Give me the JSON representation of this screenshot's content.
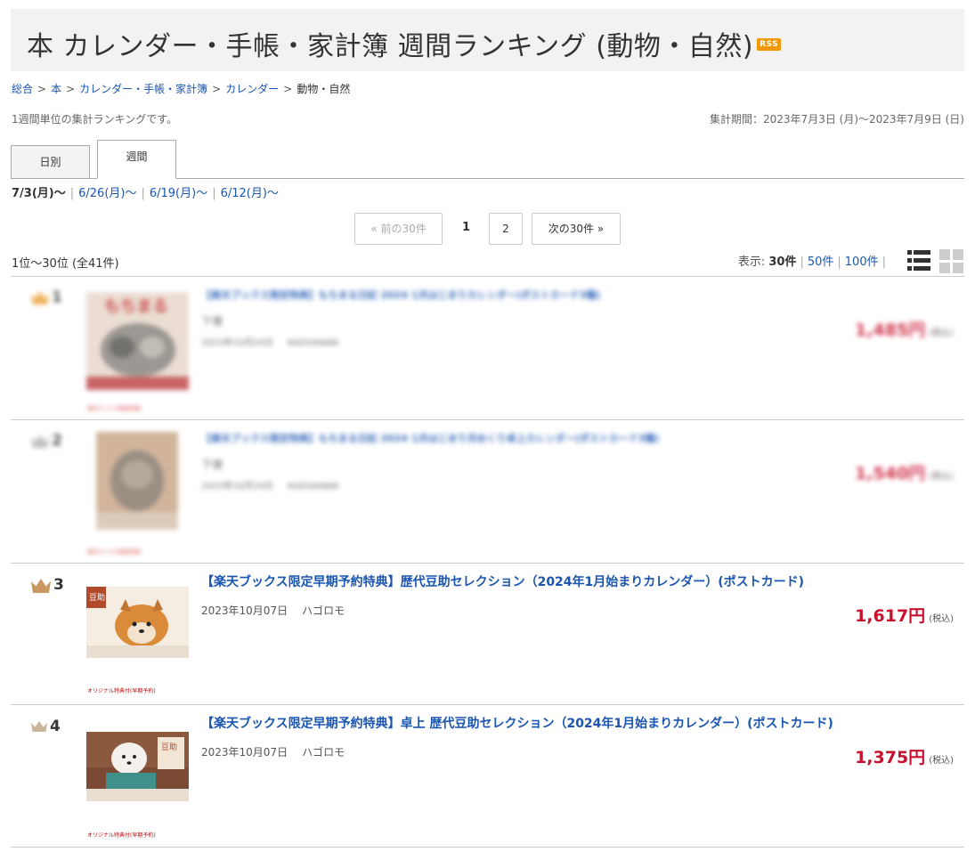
{
  "header": {
    "title": "本 カレンダー・手帳・家計簿 週間ランキング (動物・自然)",
    "rss_label": "RSS"
  },
  "breadcrumb": {
    "items": [
      "総合",
      "本",
      "カレンダー・手帳・家計簿",
      "カレンダー"
    ],
    "current": "動物・自然",
    "separator": ">"
  },
  "description": "1週間単位の集計ランキングです。",
  "period": "集計期間：2023年7月3日 (月)〜2023年7月9日 (日)",
  "tabs": [
    "日別",
    "週間"
  ],
  "active_tab": "週間",
  "weeks": {
    "current": "7/3(月)〜",
    "others": [
      "6/26(月)〜",
      "6/19(月)〜",
      "6/12(月)〜"
    ]
  },
  "pager": {
    "prev": "« 前の30件",
    "current_page": "1",
    "next_page": "2",
    "next": "次の30件 »"
  },
  "range_text": "1位〜30位 (全41件)",
  "display": {
    "label": "表示: ",
    "current": "30件",
    "options": [
      "50件",
      "100件"
    ]
  },
  "colors": {
    "link": "#1a55b0",
    "price": "#c8102e",
    "rss": "#f39800",
    "gold": "#e9a23b",
    "silver": "#b5b5b5",
    "bronze": "#c99760"
  },
  "items": [
    {
      "rank": "1",
      "crown": "gold-crown-icon",
      "title": "【楽天ブックス限定特典】もちまる日記 2024 1月はじまりカレンダー(ポストカード3種)",
      "date": "2023年10月24日",
      "publisher": "KADOKAWA",
      "author": "下僕",
      "price": "1,485円",
      "tax": "(税込)",
      "tag": "楽天ブックス限定特典",
      "blurred": true
    },
    {
      "rank": "2",
      "crown": "silver-crown-icon",
      "title": "【楽天ブックス限定特典】もちまる日記 2024 1月はじまり月めくり卓上カレンダー(ポストカード3種)",
      "date": "2023年10月24日",
      "publisher": "KADOKAWA",
      "author": "下僕",
      "price": "1,540円",
      "tax": "(税込)",
      "tag": "楽天ブックス限定特典",
      "blurred": true
    },
    {
      "rank": "3",
      "crown": "bronze-crown-icon",
      "title": "【楽天ブックス限定早期予約特典】歴代豆助セレクション（2024年1月始まりカレンダー）(ポストカード)",
      "date": "2023年10月07日",
      "publisher": "ハゴロモ",
      "price": "1,617円",
      "tax": "(税込)",
      "tag": "オリジナル特典付(早期予約)",
      "blurred": false
    },
    {
      "rank": "4",
      "crown": "small-crown-icon",
      "title": "【楽天ブックス限定早期予約特典】卓上 歴代豆助セレクション（2024年1月始まりカレンダー）(ポストカード)",
      "date": "2023年10月07日",
      "publisher": "ハゴロモ",
      "price": "1,375円",
      "tax": "(税込)",
      "tag": "オリジナル特典付(早期予約)",
      "blurred": false
    }
  ]
}
